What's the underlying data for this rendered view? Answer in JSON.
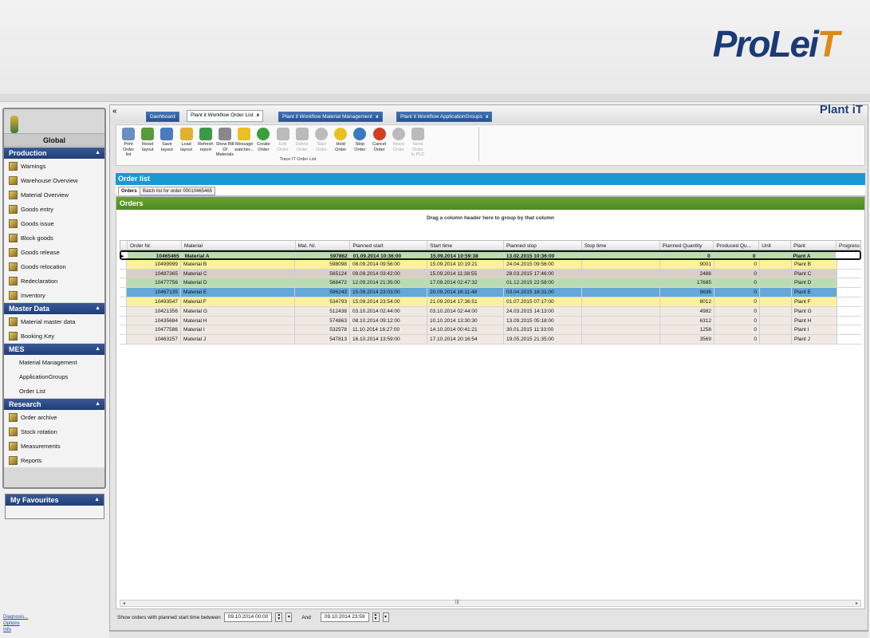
{
  "brand": {
    "logo_text": "ProLeiT",
    "app_name": "Plant iT"
  },
  "sidebar": {
    "global": "Global",
    "sections": [
      {
        "title": "Production",
        "items": [
          "Warnings",
          "Warehouse Overview",
          "Material Overview",
          "Goods entry",
          "Goods issue",
          "Block goods",
          "Goods release",
          "Goods relocation",
          "Redeclaration",
          "Inventory"
        ]
      },
      {
        "title": "Master Data",
        "items": [
          "Material master data",
          "Booking Key"
        ]
      },
      {
        "title": "MES",
        "items": [
          "Material Management",
          "ApplicationGroups",
          "Order List"
        ]
      },
      {
        "title": "Research",
        "items": [
          "Order archive",
          "Stock rotation",
          "Measurements",
          "Reports"
        ]
      }
    ],
    "favourites": "My Favourites",
    "bottom_links": [
      "Diagnosis...",
      "Options",
      "Info"
    ]
  },
  "tabs": [
    {
      "label": "Dashboard"
    },
    {
      "label": "Plant it Workflow Order List",
      "active": true
    },
    {
      "label": "Plant it Workflow Material Management"
    },
    {
      "label": "Plant it Workflow ApplicationGroups"
    }
  ],
  "ribbon": {
    "buttons": [
      {
        "l1": "Print Order",
        "l2": "list",
        "icon": "printer-icon",
        "color": "#6a8fc0"
      },
      {
        "l1": "Reset",
        "l2": "layout",
        "icon": "reset-layout-icon",
        "color": "#5a9a3a"
      },
      {
        "l1": "Save",
        "l2": "layout",
        "icon": "save-layout-icon",
        "color": "#4a7ac0"
      },
      {
        "l1": "Load",
        "l2": "layout",
        "icon": "folder-icon",
        "color": "#e0b030"
      },
      {
        "l1": "Refresh",
        "l2": "report",
        "icon": "refresh-icon",
        "color": "#3a9a4a"
      },
      {
        "l1": "Show Bill Of",
        "l2": "Materials",
        "icon": "list-icon",
        "color": "#888888"
      },
      {
        "l1": "Message",
        "l2": "watcher...",
        "icon": "warning-icon",
        "color": "#e8c020"
      },
      {
        "l1": "Create",
        "l2": "Order",
        "icon": "create-icon",
        "color": "#3aa03a"
      },
      {
        "l1": "Edit",
        "l2": "Order",
        "icon": "edit-icon",
        "color": "#bbbbbb",
        "disabled": true
      },
      {
        "l1": "Delete",
        "l2": "Order",
        "icon": "trash-icon",
        "color": "#bbbbbb",
        "disabled": true
      },
      {
        "l1": "Start",
        "l2": "Order",
        "icon": "play-icon",
        "color": "#bbbbbb",
        "disabled": true
      },
      {
        "l1": "Hold",
        "l2": "Order",
        "icon": "pause-icon",
        "color": "#e8c020"
      },
      {
        "l1": "Stop",
        "l2": "Order",
        "icon": "stop-icon",
        "color": "#3a7ac0"
      },
      {
        "l1": "Cancel",
        "l2": "Order",
        "icon": "power-icon",
        "color": "#d04020"
      },
      {
        "l1": "Reset",
        "l2": "Order",
        "icon": "undo-icon",
        "color": "#bbbbbb",
        "disabled": true
      },
      {
        "l1": "Send Order",
        "l2": "to PLC",
        "icon": "send-plc-icon",
        "color": "#bbbbbb",
        "disabled": true
      }
    ],
    "group_label": "Trace IT Order List"
  },
  "order_list_title": "Order list",
  "subtabs": [
    "Orders",
    "Batch list for order 00010465465"
  ],
  "orders_header": "Orders",
  "group_hint": "Drag a column header here to group by that column",
  "columns": [
    "Order Nr.",
    "Material",
    "Mat. Nr.",
    "Planned start",
    "Start time",
    "Planned stop",
    "Stop time",
    "Planned Quantity",
    "Produced Qu...",
    "Unit",
    "Plant",
    "Progress"
  ],
  "rows": [
    {
      "order": "10465465",
      "material": "Material A",
      "mat": "597862",
      "pstart": "01.09.2014 10:36:00",
      "start": "15.09.2014 10:59:38",
      "pstop": "13.02.2015 10:36:00",
      "stop": "",
      "pqty": "0",
      "prod": "0",
      "unit": "",
      "plant": "Plant A",
      "color": "#b9dcb1",
      "selected": true
    },
    {
      "order": "10499999",
      "material": "Material B",
      "mat": "598098",
      "pstart": "08.09.2014 09:56:00",
      "start": "15.09.2014 10:19:21",
      "pstop": "24.04.2015 09:56:00",
      "stop": "",
      "pqty": "9001",
      "prod": "0",
      "unit": "",
      "plant": "Plant B",
      "color": "#fbf29a"
    },
    {
      "order": "10487365",
      "material": "Material C",
      "mat": "565124",
      "pstart": "09.09.2014 03:42:00",
      "start": "15.09.2014 11:38:55",
      "pstop": "28.03.2015 17:46:00",
      "stop": "",
      "pqty": "2486",
      "prod": "0",
      "unit": "",
      "plant": "Plant C",
      "color": "#d8cfc6"
    },
    {
      "order": "10477756",
      "material": "Material D",
      "mat": "568472",
      "pstart": "12.09.2014 21:35:00",
      "start": "17.09.2014 02:47:32",
      "pstop": "01.12.2015 22:58:00",
      "stop": "",
      "pqty": "17685",
      "prod": "0",
      "unit": "",
      "plant": "Plant D",
      "color": "#b9dcb1"
    },
    {
      "order": "10467135",
      "material": "Material E",
      "mat": "596243",
      "pstart": "15.09.2014 23:03:00",
      "start": "20.09.2014 16:11:48",
      "pstop": "03.04.2015 18:31:00",
      "stop": "",
      "pqty": "9636",
      "prod": "0",
      "unit": "",
      "plant": "Plant E",
      "color": "#64a8d8"
    },
    {
      "order": "10493547",
      "material": "Material F",
      "mat": "534793",
      "pstart": "15.09.2014 23:54:00",
      "start": "21.09.2014 17:36:51",
      "pstop": "01.07.2015 07:17:00",
      "stop": "",
      "pqty": "8012",
      "prod": "0",
      "unit": "",
      "plant": "Plant F",
      "color": "#fbf29a"
    },
    {
      "order": "10421356",
      "material": "Material G",
      "mat": "512438",
      "pstart": "03.10.2014 02:44:00",
      "start": "03.10.2014 02:44:00",
      "pstop": "24.03.2015 14:13:00",
      "stop": "",
      "pqty": "4982",
      "prod": "0",
      "unit": "",
      "plant": "Plant G",
      "color": "#f1e8e4"
    },
    {
      "order": "10435684",
      "material": "Material H",
      "mat": "574863",
      "pstart": "08.10.2014 09:12:00",
      "start": "10.10.2014 13:30:30",
      "pstop": "13.09.2015 05:18:00",
      "stop": "",
      "pqty": "6312",
      "prod": "0",
      "unit": "",
      "plant": "Plant H",
      "color": "#f1e8e4"
    },
    {
      "order": "10477586",
      "material": "Material I",
      "mat": "532578",
      "pstart": "11.10.2014 16:27:00",
      "start": "14.10.2014 00:41:21",
      "pstop": "30.01.2015 11:33:00",
      "stop": "",
      "pqty": "1258",
      "prod": "0",
      "unit": "",
      "plant": "Plant I",
      "color": "#f1e8e4"
    },
    {
      "order": "10463257",
      "material": "Material J",
      "mat": "547813",
      "pstart": "16.10.2014 13:59:00",
      "start": "17.10.2014 20:16:54",
      "pstop": "19.05.2015 21:35:00",
      "stop": "",
      "pqty": "3569",
      "prod": "0",
      "unit": "",
      "plant": "Plant J",
      "color": "#f1e8e4"
    }
  ],
  "filter": {
    "label": "Show orders with planned start time between",
    "from": "09.10.2014 00:00",
    "and": "And",
    "to": "09.10.2014 23:59"
  }
}
